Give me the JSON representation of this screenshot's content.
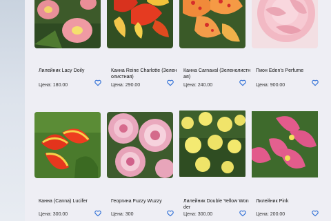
{
  "accent_color": "#2f6fd6",
  "products": [
    {
      "name": "Лилейник Lacy Doily",
      "price_label": "Цена:",
      "price": "180.00",
      "fav_icon": "heart-outline-icon",
      "photo": "pink-daylily"
    },
    {
      "name": "Канна Reine Charlotte (Зеленолистная)",
      "price_label": "Цена:",
      "price": "290.00",
      "fav_icon": "heart-outline-icon",
      "photo": "red-yellow-canna"
    },
    {
      "name": "Канна Carnaval (Зеленолистная)",
      "price_label": "Цена:",
      "price": "240.00",
      "fav_icon": "heart-outline-icon",
      "photo": "orange-spotted-canna"
    },
    {
      "name": "Пион Eden's Perfume",
      "price_label": "Цена:",
      "price": "900.00",
      "fav_icon": "heart-outline-icon",
      "photo": "pink-peony"
    },
    {
      "name": "Канна (Canna) Lucifer",
      "price_label": "Цена:",
      "price": "300.00",
      "fav_icon": "heart-outline-icon",
      "photo": "lucifer-canna"
    },
    {
      "name": "Георгина Fuzzy Wuzzy",
      "price_label": "Цена:",
      "price": "300",
      "fav_icon": "heart-outline-icon",
      "photo": "pink-dahlia"
    },
    {
      "name": "Лилейник Double Yellow Wonder",
      "price_label": "Цена:",
      "price": "300.00",
      "fav_icon": "heart-outline-icon",
      "photo": "yellow-daylily"
    },
    {
      "name": "Лилейник Pink",
      "price_label": "Цена:",
      "price": "200.00",
      "fav_icon": "heart-outline-icon",
      "photo": "pink-daylily-2"
    }
  ]
}
